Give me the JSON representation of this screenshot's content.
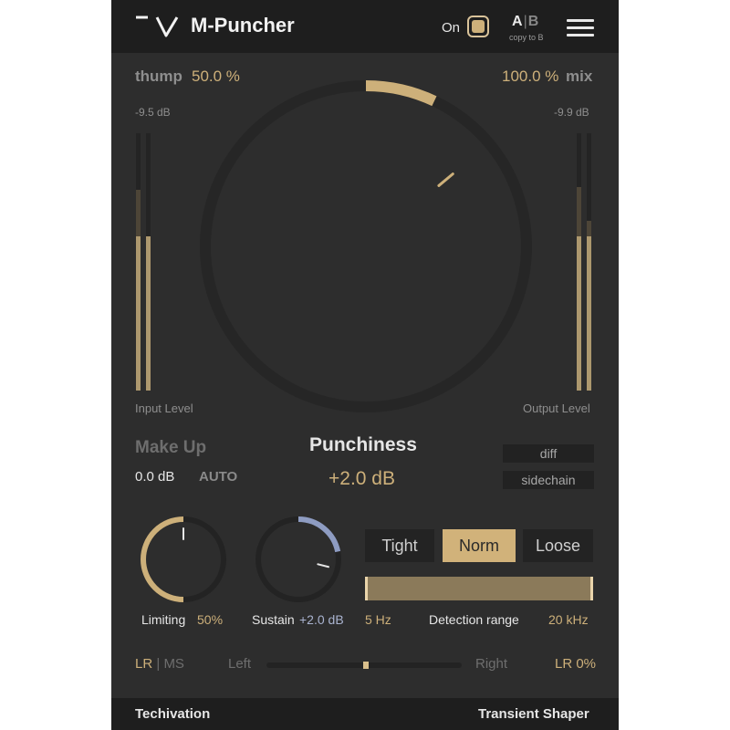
{
  "header": {
    "title": "M-Puncher",
    "on_label": "On",
    "on_state": true,
    "ab_a": "A",
    "ab_sep": "|",
    "ab_b": "B",
    "copy_label": "copy to B",
    "menu_icon": "hamburger-menu-icon"
  },
  "thump": {
    "label": "thump",
    "value": "50.0 %"
  },
  "mix": {
    "label": "mix",
    "value": "100.0 %"
  },
  "input": {
    "db": "-9.5 dB",
    "label": "Input Level",
    "levels": [
      0.6,
      0.6
    ],
    "peaks": [
      0.78,
      0.0
    ]
  },
  "output": {
    "db": "-9.9 dB",
    "label": "Output Level",
    "levels": [
      0.6,
      0.6
    ],
    "peaks": [
      0.79,
      0.66
    ]
  },
  "punchiness": {
    "label": "Punchiness",
    "value": "+2.0 dB",
    "level": 0.07
  },
  "makeup": {
    "label": "Make Up",
    "value": "0.0 dB",
    "auto": "AUTO"
  },
  "toggles": {
    "diff": "diff",
    "sidechain": "sidechain"
  },
  "limiting": {
    "label": "Limiting",
    "value": "50%",
    "level": 0.5
  },
  "sustain": {
    "label": "Sustain",
    "value": "+2.0 dB",
    "level": 0.58
  },
  "detection": {
    "modes": [
      "Tight",
      "Norm",
      "Loose"
    ],
    "selected": "Norm",
    "low": "5 Hz",
    "label": "Detection range",
    "high": "20 kHz"
  },
  "stereo": {
    "lr": "LR",
    "sep": "|",
    "ms": "MS",
    "left": "Left",
    "right": "Right",
    "value": "LR 0%",
    "balance": 0.5
  },
  "footer": {
    "brand": "Techivation",
    "product": "Transient Shaper"
  },
  "colors": {
    "accent": "#cdb07a",
    "sustain_accent": "#8e9cc2",
    "background": "#2d2d2d",
    "bar": "#1e1e1e"
  }
}
